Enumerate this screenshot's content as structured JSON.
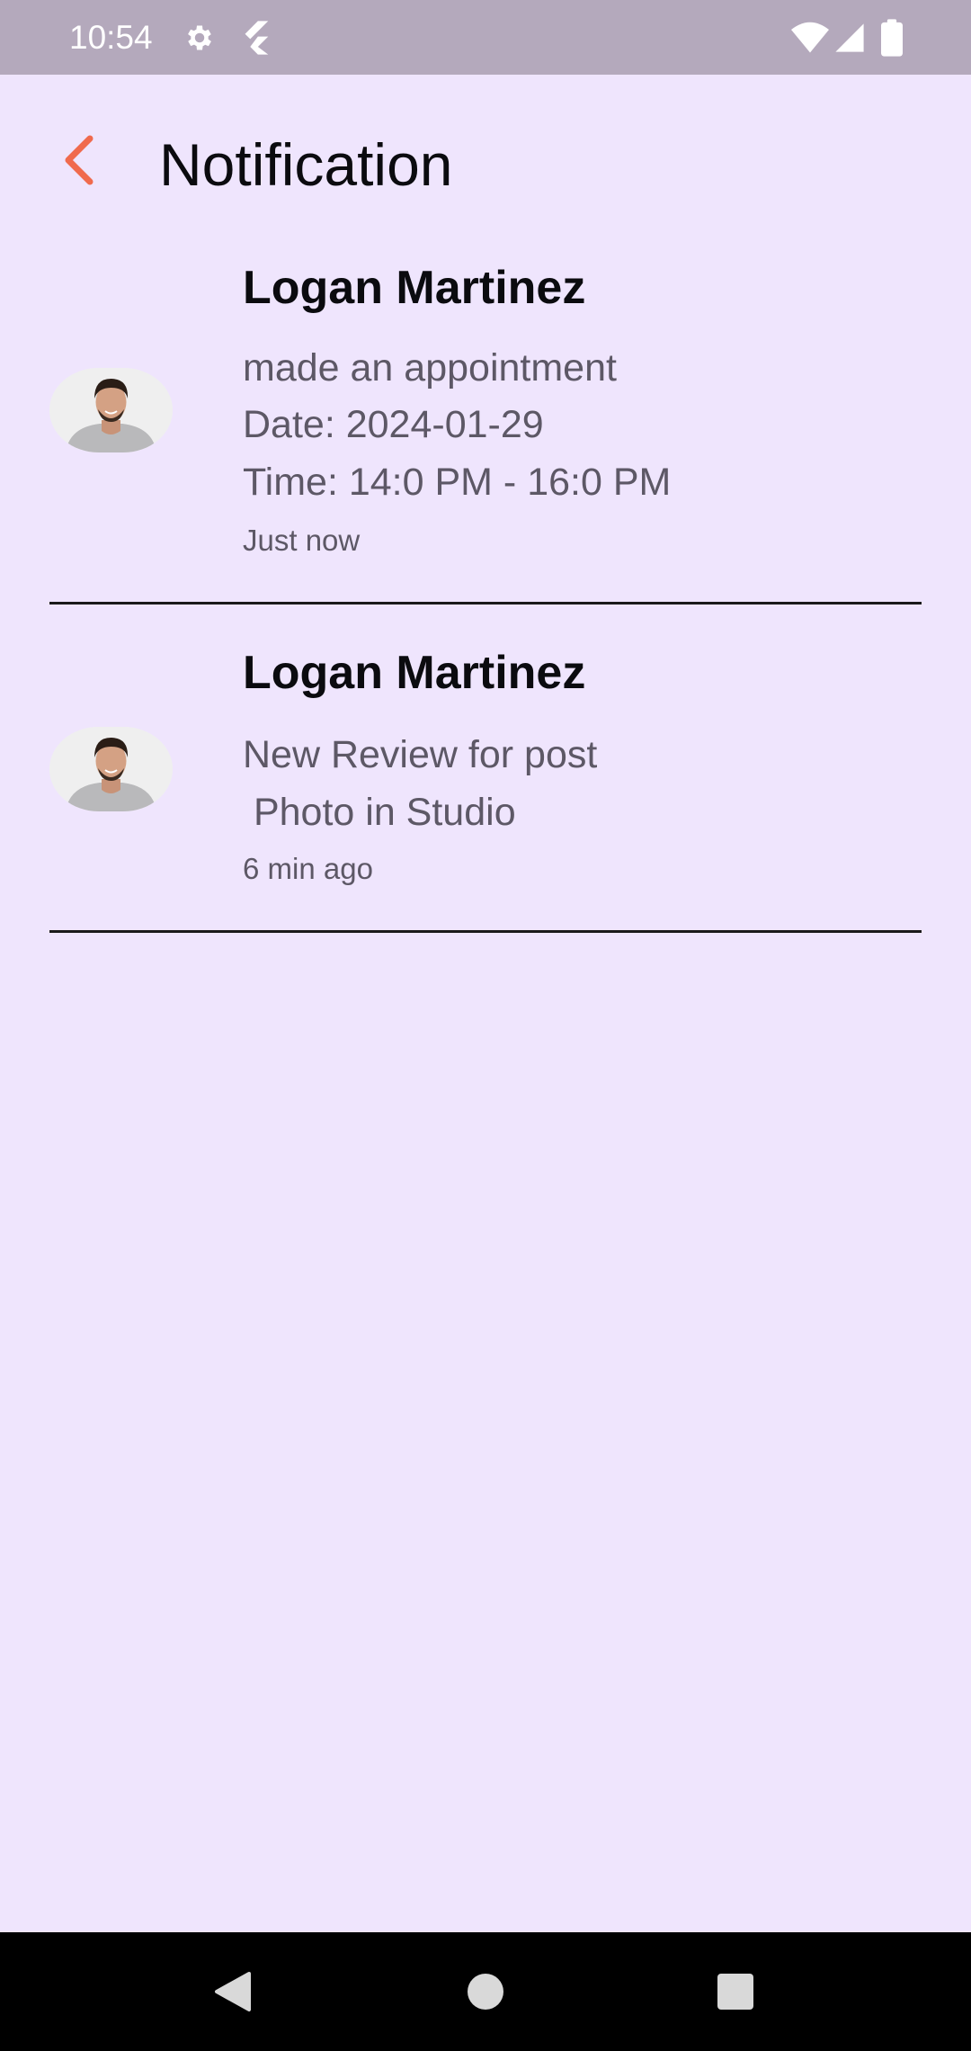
{
  "status_bar": {
    "time": "10:54",
    "icons": [
      "settings-gear-icon",
      "flutter-icon",
      "wifi-icon",
      "cellular-signal-icon",
      "battery-icon"
    ]
  },
  "header": {
    "back_icon": "chevron-left-icon",
    "title": "Notification"
  },
  "colors": {
    "background": "#EFE5FD",
    "status_bar": "#B4A9BC",
    "accent_back": "#F06A4D",
    "title_text": "#0B0B0F",
    "secondary_text": "#5D5866",
    "divider": "#1A1A1A",
    "nav_bar": "#000000"
  },
  "notifications": [
    {
      "name": "Logan Martinez",
      "lines": [
        "made an appointment",
        "Date: 2024-01-29",
        "Time: 14:0 PM - 16:0 PM"
      ],
      "time": "Just now"
    },
    {
      "name": "Logan Martinez",
      "lines": [
        "New Review for post",
        " Photo in Studio"
      ],
      "time": "6 min ago"
    }
  ],
  "nav_bar": {
    "icons": [
      "back-triangle-icon",
      "home-circle-icon",
      "recents-square-icon"
    ]
  }
}
